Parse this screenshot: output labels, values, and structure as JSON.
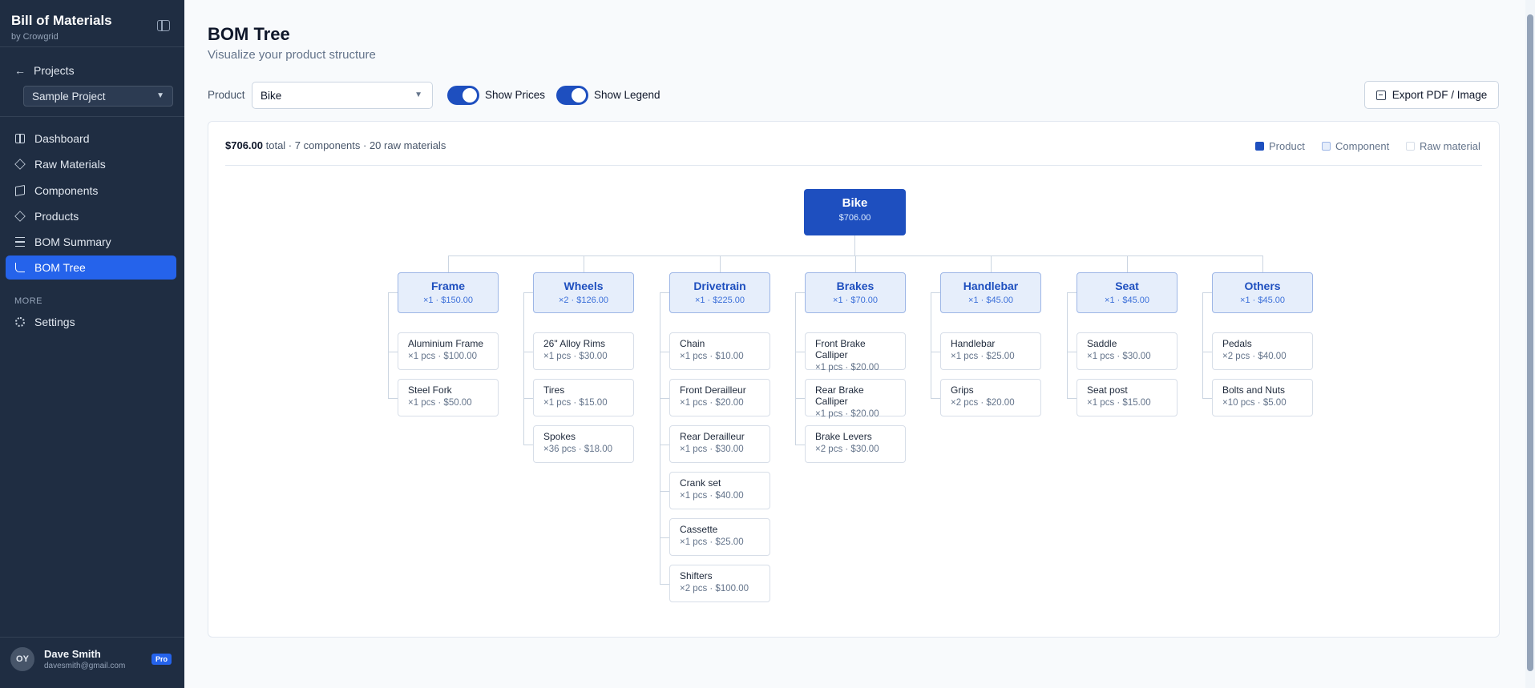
{
  "sidebar": {
    "brand": "Bill of Materials",
    "brand_sub": "by Crowgrid",
    "projects_label": "Projects",
    "project_select": "Sample Project",
    "items": [
      {
        "label": "Dashboard",
        "icon": "dashboard-icon"
      },
      {
        "label": "Raw Materials",
        "icon": "box-icon"
      },
      {
        "label": "Components",
        "icon": "layers-icon"
      },
      {
        "label": "Products",
        "icon": "box-icon"
      },
      {
        "label": "BOM Summary",
        "icon": "list-icon"
      },
      {
        "label": "BOM Tree",
        "icon": "branch-icon",
        "active": true
      }
    ],
    "more_label": "MORE",
    "settings_label": "Settings",
    "user": {
      "initials": "OY",
      "name": "Dave Smith",
      "email": "davesmith@gmail.com",
      "badge": "Pro"
    }
  },
  "header": {
    "title": "BOM Tree",
    "subtitle": "Visualize your product structure"
  },
  "controls": {
    "product_label": "Product",
    "product_value": "Bike",
    "show_prices_label": "Show Prices",
    "show_prices_on": true,
    "show_legend_label": "Show Legend",
    "show_legend_on": true,
    "export_label": "Export PDF / Image"
  },
  "summary": {
    "total": "$706.00",
    "rest": " total · 7 components · 20 raw materials"
  },
  "legend": [
    {
      "label": "Product",
      "color": "#1e4fbf"
    },
    {
      "label": "Component",
      "color": "#e6eefb"
    },
    {
      "label": "Raw material",
      "color": "#ffffff"
    }
  ],
  "tree": {
    "root": {
      "name": "Bike",
      "price": "$706.00"
    },
    "components": [
      {
        "name": "Frame",
        "meta": "×1 · $150.00",
        "children": [
          {
            "name": "Aluminium Frame",
            "meta": "×1 pcs · $100.00"
          },
          {
            "name": "Steel Fork",
            "meta": "×1 pcs · $50.00"
          }
        ]
      },
      {
        "name": "Wheels",
        "meta": "×2 · $126.00",
        "children": [
          {
            "name": "26\" Alloy Rims",
            "meta": "×1 pcs · $30.00"
          },
          {
            "name": "Tires",
            "meta": "×1 pcs · $15.00"
          },
          {
            "name": "Spokes",
            "meta": "×36 pcs · $18.00"
          }
        ]
      },
      {
        "name": "Drivetrain",
        "meta": "×1 · $225.00",
        "children": [
          {
            "name": "Chain",
            "meta": "×1 pcs · $10.00"
          },
          {
            "name": "Front Derailleur",
            "meta": "×1 pcs · $20.00"
          },
          {
            "name": "Rear Derailleur",
            "meta": "×1 pcs · $30.00"
          },
          {
            "name": "Crank set",
            "meta": "×1 pcs · $40.00"
          },
          {
            "name": "Cassette",
            "meta": "×1 pcs · $25.00"
          },
          {
            "name": "Shifters",
            "meta": "×2 pcs · $100.00"
          }
        ]
      },
      {
        "name": "Brakes",
        "meta": "×1 · $70.00",
        "children": [
          {
            "name": "Front Brake Calliper",
            "meta": "×1 pcs · $20.00"
          },
          {
            "name": "Rear Brake Calliper",
            "meta": "×1 pcs · $20.00"
          },
          {
            "name": "Brake Levers",
            "meta": "×2 pcs · $30.00"
          }
        ]
      },
      {
        "name": "Handlebar",
        "meta": "×1 · $45.00",
        "children": [
          {
            "name": "Handlebar",
            "meta": "×1 pcs · $25.00"
          },
          {
            "name": "Grips",
            "meta": "×2 pcs · $20.00"
          }
        ]
      },
      {
        "name": "Seat",
        "meta": "×1 · $45.00",
        "children": [
          {
            "name": "Saddle",
            "meta": "×1 pcs · $30.00"
          },
          {
            "name": "Seat post",
            "meta": "×1 pcs · $15.00"
          }
        ]
      },
      {
        "name": "Others",
        "meta": "×1 · $45.00",
        "children": [
          {
            "name": "Pedals",
            "meta": "×2 pcs · $40.00"
          },
          {
            "name": "Bolts and Nuts",
            "meta": "×10 pcs · $5.00"
          }
        ]
      }
    ]
  }
}
